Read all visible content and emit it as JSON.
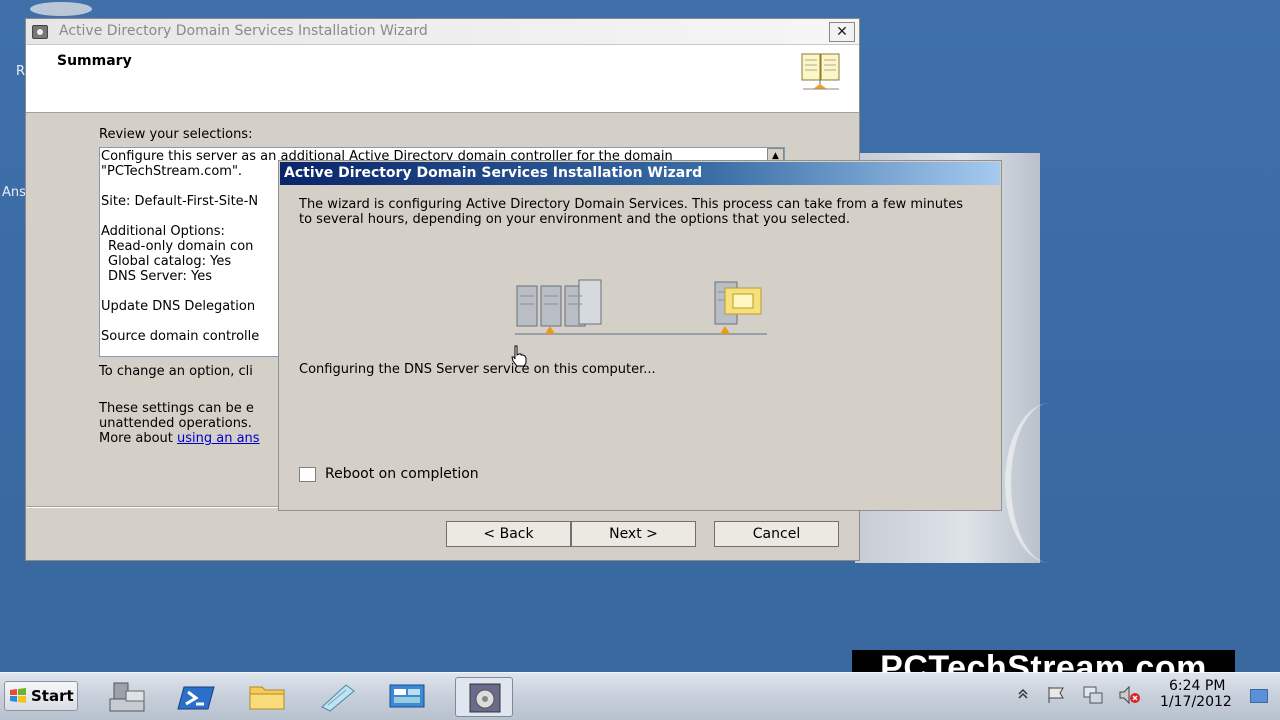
{
  "desktop": {
    "icon_label_1": "R",
    "icon_label_2": "Ans"
  },
  "wizard": {
    "title": "Active Directory Domain Services Installation Wizard",
    "close_label": "✕",
    "header_title": "Summary",
    "review_label": "Review your selections:",
    "review_lines": [
      "Configure this server as an additional Active Directory domain controller for the domain",
      "\"PCTechStream.com\".",
      "Site: Default-First-Site-N",
      "Additional Options:",
      "  Read-only domain con",
      "  Global catalog: Yes",
      "  DNS Server: Yes",
      "Update DNS Delegation",
      "Source domain controlle"
    ],
    "change_note": "To change an option, cli",
    "settings_note_1": "These settings can be e",
    "settings_note_2": "unattended operations.",
    "settings_note_3": "More about ",
    "settings_link": "using an ans",
    "back_label": "< Back",
    "next_label": "Next >",
    "cancel_label": "Cancel"
  },
  "progress": {
    "title": "Active Directory Domain Services Installation Wizard",
    "description": "The wizard is configuring Active Directory Domain Services. This process can take from a few minutes to several hours, depending on your environment and the options that you selected.",
    "status": "Configuring the DNS Server service on this computer...",
    "reboot_label": "Reboot on completion",
    "reboot_checked": false
  },
  "taskbar": {
    "start_label": "Start",
    "items": [
      "server-manager",
      "powershell",
      "explorer",
      "notepad",
      "network-tool",
      "ad-wizard"
    ],
    "clock_time": "6:24 PM",
    "clock_date": "1/17/2012"
  },
  "watermark": "PCTechStream.com",
  "colors": {
    "desktop": "#3a6ea5",
    "dialog": "#d4d0c8",
    "active_title": "#0a246a",
    "link": "#0000cc"
  }
}
